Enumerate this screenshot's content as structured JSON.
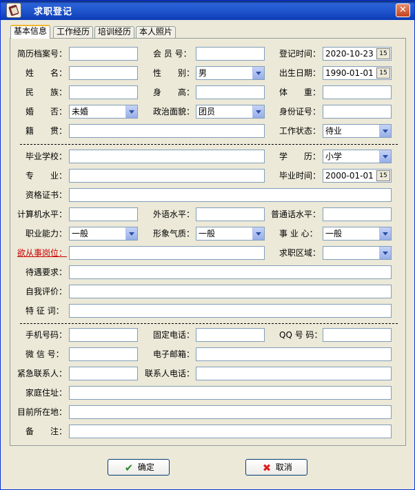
{
  "window": {
    "title": "求职登记"
  },
  "tabs": [
    "基本信息",
    "工作经历",
    "培训经历",
    "本人照片"
  ],
  "labels": {
    "archive_no": "简历档案号：",
    "member_no": "会 员 号：",
    "reg_time": "登记时间：",
    "name": "姓　　名：",
    "gender": "性　　别：",
    "birth": "出生日期：",
    "ethnicity": "民　　族：",
    "height": "身　　高：",
    "weight": "体　　重：",
    "marital": "婚　　否：",
    "political": "政治面貌：",
    "id_no": "身份证号：",
    "native": "籍　　贯：",
    "work_status": "工作状态：",
    "school": "毕业学校：",
    "education": "学　　历：",
    "major": "专　　业：",
    "grad_time": "毕业时间：",
    "certificate": "资格证书：",
    "computer": "计算机水平：",
    "foreign": "外语水平：",
    "mandarin": "普通话水平：",
    "ability": "职业能力：",
    "image": "形象气质：",
    "career": "事 业 心：",
    "desired_post": "欲从事岗位：",
    "job_region": "求职区域：",
    "salary": "待遇要求：",
    "self_eval": "自我评价：",
    "traits": "特 征 词：",
    "mobile": "手机号码：",
    "phone": "固定电话：",
    "qq": "QQ 号 码：",
    "wechat": "微 信 号：",
    "email": "电子邮箱：",
    "emergency": "紧急联系人：",
    "contact_phone": "联系人电话：",
    "address": "家庭住址：",
    "current": "目前所在地：",
    "remark": "备　　注："
  },
  "values": {
    "reg_time": "2020-10-23",
    "gender": "男",
    "birth": "1990-01-01",
    "marital": "未婚",
    "political": "团员",
    "work_status": "待业",
    "education": "小学",
    "grad_time": "2000-01-01",
    "ability": "一般",
    "image": "一般",
    "career": "一般",
    "calendar_icon_text": "15"
  },
  "buttons": {
    "ok": "确定",
    "cancel": "取消"
  }
}
